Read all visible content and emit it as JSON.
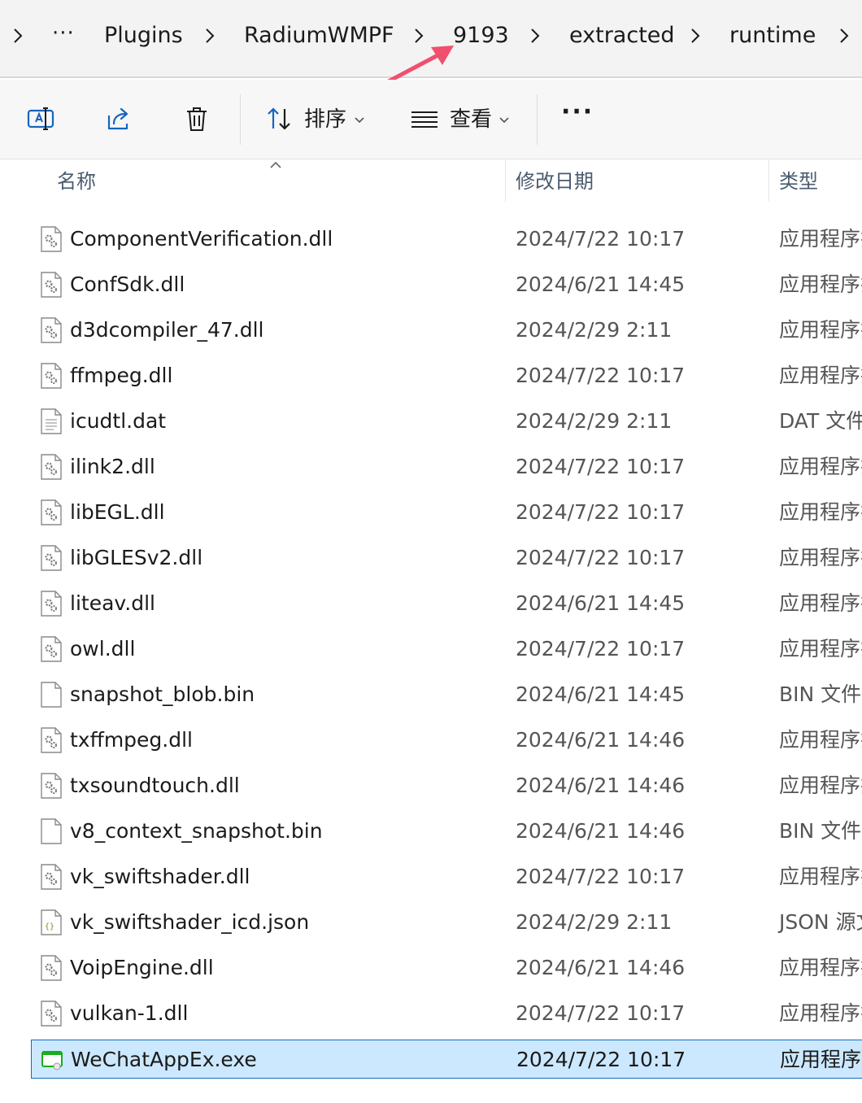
{
  "breadcrumb": {
    "overflow_label": "···",
    "items": [
      "Plugins",
      "RadiumWMPF",
      "9193",
      "extracted",
      "runtime"
    ]
  },
  "toolbar": {
    "sort_label": "排序",
    "view_label": "查看",
    "more_label": "···"
  },
  "columns": {
    "name": "名称",
    "date": "修改日期",
    "type": "类型"
  },
  "files": [
    {
      "name": "ComponentVerification.dll",
      "date": "2024/7/22 10:17",
      "type": "应用程序扩展",
      "icon": "dll-file-icon"
    },
    {
      "name": "ConfSdk.dll",
      "date": "2024/6/21 14:45",
      "type": "应用程序扩展",
      "icon": "dll-file-icon"
    },
    {
      "name": "d3dcompiler_47.dll",
      "date": "2024/2/29 2:11",
      "type": "应用程序扩展",
      "icon": "dll-file-icon"
    },
    {
      "name": "ffmpeg.dll",
      "date": "2024/7/22 10:17",
      "type": "应用程序扩展",
      "icon": "dll-file-icon"
    },
    {
      "name": "icudtl.dat",
      "date": "2024/2/29 2:11",
      "type": "DAT 文件",
      "icon": "text-file-icon"
    },
    {
      "name": "ilink2.dll",
      "date": "2024/7/22 10:17",
      "type": "应用程序扩展",
      "icon": "dll-file-icon"
    },
    {
      "name": "libEGL.dll",
      "date": "2024/7/22 10:17",
      "type": "应用程序扩展",
      "icon": "dll-file-icon"
    },
    {
      "name": "libGLESv2.dll",
      "date": "2024/7/22 10:17",
      "type": "应用程序扩展",
      "icon": "dll-file-icon"
    },
    {
      "name": "liteav.dll",
      "date": "2024/6/21 14:45",
      "type": "应用程序扩展",
      "icon": "dll-file-icon"
    },
    {
      "name": "owl.dll",
      "date": "2024/7/22 10:17",
      "type": "应用程序扩展",
      "icon": "dll-file-icon"
    },
    {
      "name": "snapshot_blob.bin",
      "date": "2024/6/21 14:45",
      "type": "BIN 文件",
      "icon": "blank-file-icon"
    },
    {
      "name": "txffmpeg.dll",
      "date": "2024/6/21 14:46",
      "type": "应用程序扩展",
      "icon": "dll-file-icon"
    },
    {
      "name": "txsoundtouch.dll",
      "date": "2024/6/21 14:46",
      "type": "应用程序扩展",
      "icon": "dll-file-icon"
    },
    {
      "name": "v8_context_snapshot.bin",
      "date": "2024/6/21 14:46",
      "type": "BIN 文件",
      "icon": "blank-file-icon"
    },
    {
      "name": "vk_swiftshader.dll",
      "date": "2024/7/22 10:17",
      "type": "应用程序扩展",
      "icon": "dll-file-icon"
    },
    {
      "name": "vk_swiftshader_icd.json",
      "date": "2024/2/29 2:11",
      "type": "JSON 源文件",
      "icon": "json-file-icon"
    },
    {
      "name": "VoipEngine.dll",
      "date": "2024/6/21 14:46",
      "type": "应用程序扩展",
      "icon": "dll-file-icon"
    },
    {
      "name": "vulkan-1.dll",
      "date": "2024/7/22 10:17",
      "type": "应用程序扩展",
      "icon": "dll-file-icon"
    },
    {
      "name": "WeChatAppEx.exe",
      "date": "2024/7/22 10:17",
      "type": "应用程序",
      "icon": "exe-file-icon",
      "selected": true
    }
  ],
  "colors": {
    "selection_bg": "#cce8ff",
    "selection_border": "#0f6cbd",
    "annotation_arrow": "#f0506e"
  }
}
